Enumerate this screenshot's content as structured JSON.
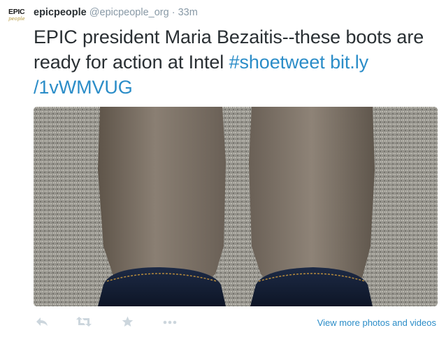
{
  "avatar": {
    "line1": "EPIC",
    "line2": "people"
  },
  "tweet": {
    "display_name": "epicpeople",
    "handle": "@epicpeople_org",
    "separator": "·",
    "time": "33m",
    "text_plain": "EPIC president Maria Bezaitis--these boots are ready for action at Intel ",
    "hashtag": "#shoetweet",
    "link_part1": "bit.ly",
    "link_part2": "/1vWMVUG"
  },
  "actions": {
    "reply": "reply-icon",
    "retweet": "retweet-icon",
    "favorite": "star-icon",
    "more": "more-dots-icon",
    "view_more": "View more photos and videos"
  },
  "colors": {
    "link": "#2b8dc8",
    "muted": "#8899a6",
    "icon": "#ccd6dd"
  }
}
